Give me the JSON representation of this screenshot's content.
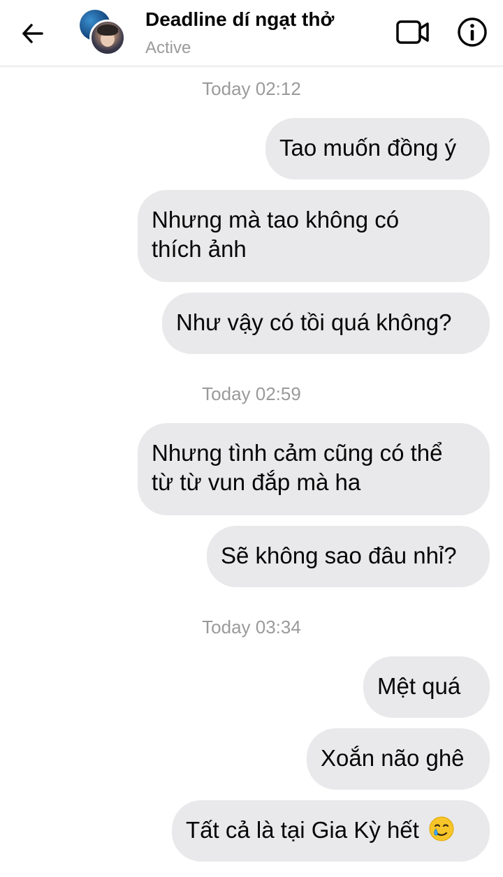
{
  "header": {
    "title": "Deadline dí ngạt thở",
    "status": "Active",
    "back_icon": "arrow-left-icon",
    "video_icon": "video-call-icon",
    "info_icon": "info-icon"
  },
  "timestamps": [
    "Today 02:12",
    "Today 02:59",
    "Today 03:34"
  ],
  "messages": [
    {
      "line1": "Tao muốn đồng ý",
      "line2": ""
    },
    {
      "line1": "Nhưng mà tao không có",
      "line2": "thích ảnh"
    },
    {
      "line1": "Như vậy có tồi quá không?",
      "line2": ""
    },
    {
      "line1": "Nhưng tình cảm cũng có thể",
      "line2": "từ từ vun đắp mà ha"
    },
    {
      "line1": "Sẽ không sao đâu nhỉ?",
      "line2": ""
    },
    {
      "line1": "Mệt quá",
      "line2": ""
    },
    {
      "line1": "Xoắn não ghê",
      "line2": ""
    },
    {
      "line1": "Tất cả là tại Gia Kỳ hết",
      "line2": "",
      "emoji": "smiling-face-with-tear-icon"
    }
  ],
  "colors": {
    "bubble": "#e9e9eb",
    "text": "#050505",
    "muted": "#9a9a9a"
  }
}
